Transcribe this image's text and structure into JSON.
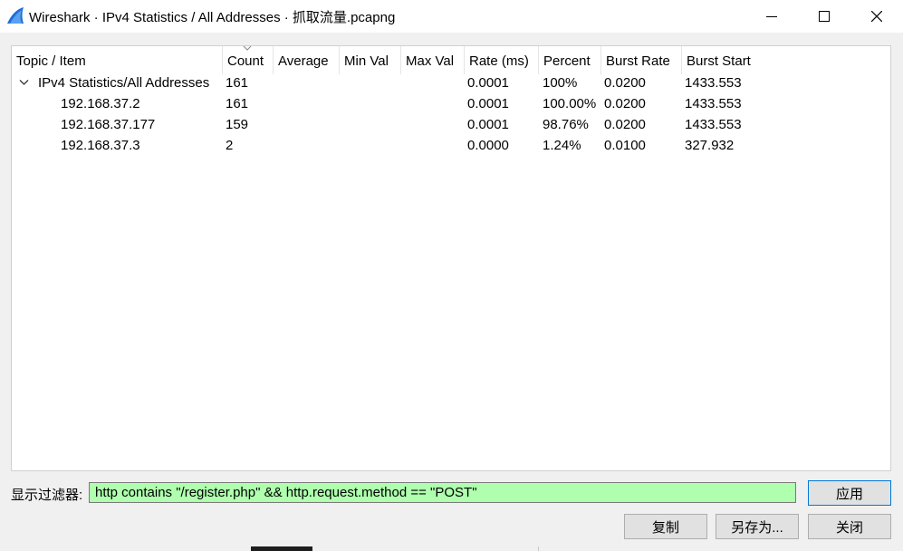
{
  "window": {
    "title": "Wireshark · IPv4 Statistics / All Addresses · 抓取流量.pcapng",
    "app_icon": "wireshark-fin-icon",
    "controls": [
      "minimize-icon",
      "maximize-icon",
      "close-icon"
    ]
  },
  "table": {
    "columns": [
      "Topic / Item",
      "Count",
      "Average",
      "Min Val",
      "Max Val",
      "Rate (ms)",
      "Percent",
      "Burst Rate",
      "Burst Start"
    ],
    "sorted_column": "Count",
    "rows": [
      {
        "topic": "IPv4 Statistics/All Addresses",
        "count": "161",
        "average": "",
        "min_val": "",
        "max_val": "",
        "rate": "0.0001",
        "percent": "100%",
        "burst_rate": "0.0200",
        "burst_start": "1433.553",
        "expanded": true
      },
      {
        "topic": "192.168.37.2",
        "count": "161",
        "average": "",
        "min_val": "",
        "max_val": "",
        "rate": "0.0001",
        "percent": "100.00%",
        "burst_rate": "0.0200",
        "burst_start": "1433.553"
      },
      {
        "topic": "192.168.37.177",
        "count": "159",
        "average": "",
        "min_val": "",
        "max_val": "",
        "rate": "0.0001",
        "percent": "98.76%",
        "burst_rate": "0.0200",
        "burst_start": "1433.553"
      },
      {
        "topic": "192.168.37.3",
        "count": "2",
        "average": "",
        "min_val": "",
        "max_val": "",
        "rate": "0.0000",
        "percent": "1.24%",
        "burst_rate": "0.0100",
        "burst_start": "327.932"
      }
    ]
  },
  "filter": {
    "label": "显示过滤器:",
    "value": "http contains \"/register.php\" && http.request.method == \"POST\"",
    "valid_color": "#afffaf"
  },
  "buttons": {
    "apply": "应用",
    "copy": "复制",
    "save_as": "另存为...",
    "close": "关闭"
  },
  "colors": {
    "accent": "#0078d7",
    "app_icon_blue": "#1e6fd9"
  }
}
